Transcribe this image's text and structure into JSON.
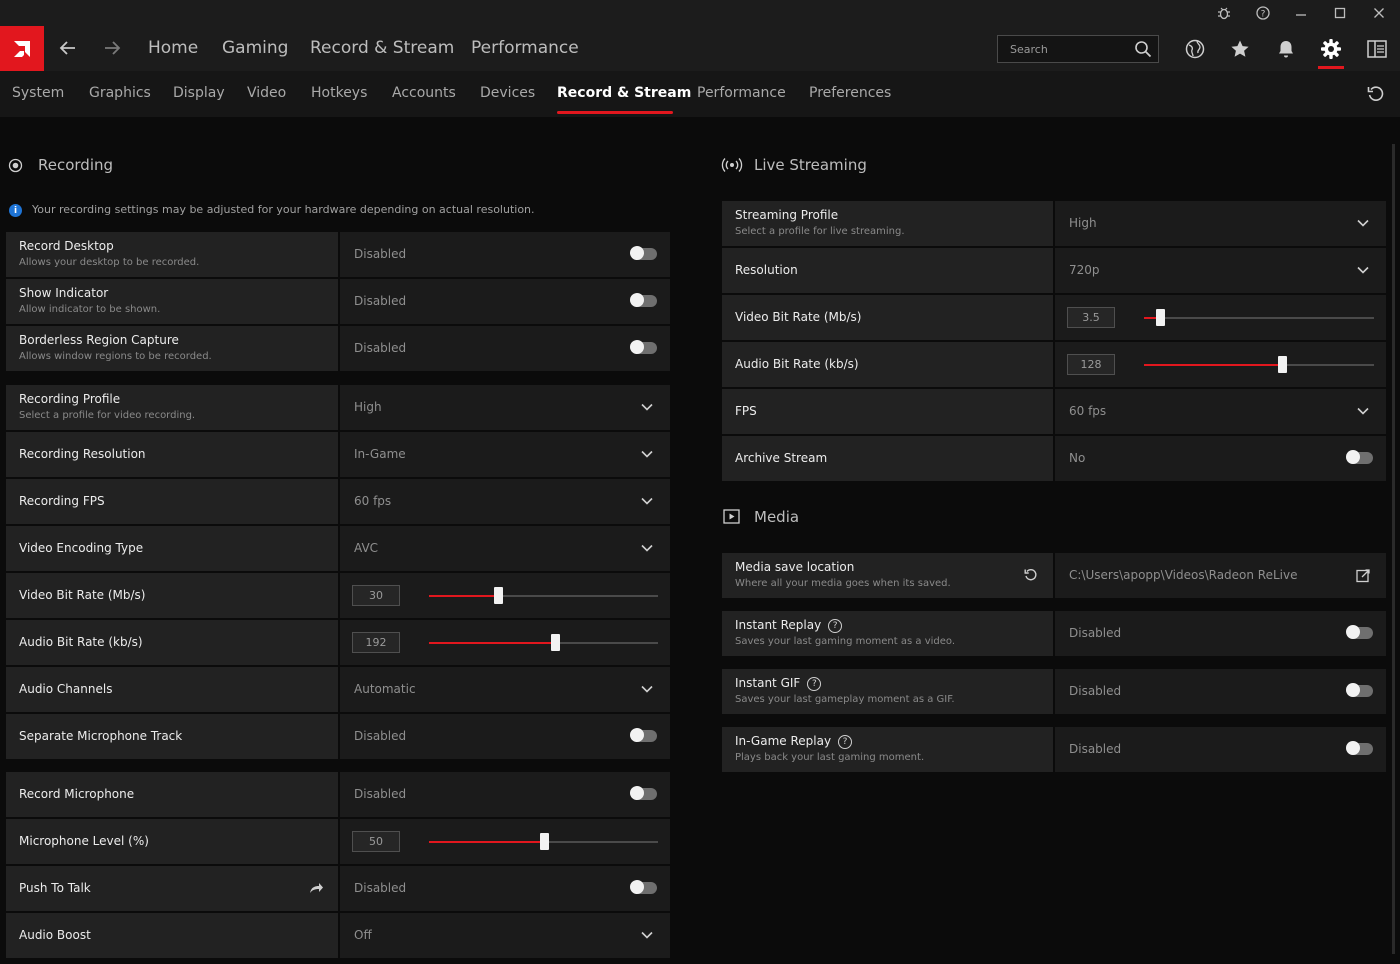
{
  "window": {
    "bug_icon": "bug-icon",
    "help_icon": "help-icon",
    "controls": [
      "minimize",
      "maximize",
      "close"
    ]
  },
  "topnav": {
    "links": [
      "Home",
      "Gaming",
      "Record & Stream",
      "Performance"
    ],
    "search_placeholder": "Search"
  },
  "subnav": {
    "tabs": [
      "System",
      "Graphics",
      "Display",
      "Video",
      "Hotkeys",
      "Accounts",
      "Devices",
      "Record & Stream",
      "Performance",
      "Preferences"
    ],
    "active": "Record & Stream"
  },
  "accent_color": "#e2171e",
  "recording": {
    "title": "Recording",
    "info": "Your recording settings may be adjusted for your hardware depending on actual resolution.",
    "rows": [
      {
        "label": "Record Desktop",
        "sub": "Allows your desktop to be recorded.",
        "value": "Disabled",
        "control": "toggle",
        "state": false
      },
      {
        "label": "Show Indicator",
        "sub": "Allow indicator to be shown.",
        "value": "Disabled",
        "control": "toggle",
        "state": false
      },
      {
        "label": "Borderless Region Capture",
        "sub": "Allows window regions to be recorded.",
        "value": "Disabled",
        "control": "toggle",
        "state": false
      },
      {
        "label": "Recording Profile",
        "sub": "Select a profile for video recording.",
        "value": "High",
        "control": "dropdown"
      },
      {
        "label": "Recording Resolution",
        "sub": "",
        "value": "In-Game",
        "control": "dropdown"
      },
      {
        "label": "Recording FPS",
        "sub": "",
        "value": "60 fps",
        "control": "dropdown"
      },
      {
        "label": "Video Encoding Type",
        "sub": "",
        "value": "AVC",
        "control": "dropdown"
      },
      {
        "label": "Video Bit Rate (Mb/s)",
        "sub": "",
        "value": "30",
        "control": "slider",
        "fraction": 0.3
      },
      {
        "label": "Audio Bit Rate (kb/s)",
        "sub": "",
        "value": "192",
        "control": "slider",
        "fraction": 0.55
      },
      {
        "label": "Audio Channels",
        "sub": "",
        "value": "Automatic",
        "control": "dropdown"
      },
      {
        "label": "Separate Microphone Track",
        "sub": "",
        "value": "Disabled",
        "control": "toggle",
        "state": false
      },
      {
        "label": "Record Microphone",
        "sub": "",
        "value": "Disabled",
        "control": "toggle",
        "state": false
      },
      {
        "label": "Microphone Level (%)",
        "sub": "",
        "value": "50",
        "control": "slider",
        "fraction": 0.5
      },
      {
        "label": "Push To Talk",
        "sub": "",
        "value": "Disabled",
        "control": "toggle",
        "state": false,
        "extra_icon": "share-arrow-icon"
      },
      {
        "label": "Audio Boost",
        "sub": "",
        "value": "Off",
        "control": "dropdown"
      }
    ]
  },
  "streaming": {
    "title": "Live Streaming",
    "rows": [
      {
        "label": "Streaming Profile",
        "sub": "Select a profile for live streaming.",
        "value": "High",
        "control": "dropdown"
      },
      {
        "label": "Resolution",
        "sub": "",
        "value": "720p",
        "control": "dropdown"
      },
      {
        "label": "Video Bit Rate (Mb/s)",
        "sub": "",
        "value": "3.5",
        "control": "slider",
        "fraction": 0.07
      },
      {
        "label": "Audio Bit Rate (kb/s)",
        "sub": "",
        "value": "128",
        "control": "slider",
        "fraction": 0.6
      },
      {
        "label": "FPS",
        "sub": "",
        "value": "60 fps",
        "control": "dropdown"
      },
      {
        "label": "Archive Stream",
        "sub": "",
        "value": "No",
        "control": "toggle",
        "state": false
      }
    ]
  },
  "media": {
    "title": "Media",
    "rows": [
      {
        "label": "Media save location",
        "sub": "Where all your media goes when its saved.",
        "value": "C:\\Users\\apopp\\Videos\\Radeon ReLive",
        "control": "path"
      },
      {
        "label": "Instant Replay",
        "sub": "Saves your last gaming moment as a video.",
        "value": "Disabled",
        "control": "toggle",
        "state": false,
        "help": true
      },
      {
        "label": "Instant GIF",
        "sub": "Saves your last gameplay moment as a GIF.",
        "value": "Disabled",
        "control": "toggle",
        "state": false,
        "help": true
      },
      {
        "label": "In-Game Replay",
        "sub": "Plays back your last gaming moment.",
        "value": "Disabled",
        "control": "toggle",
        "state": false,
        "help": true
      }
    ]
  }
}
